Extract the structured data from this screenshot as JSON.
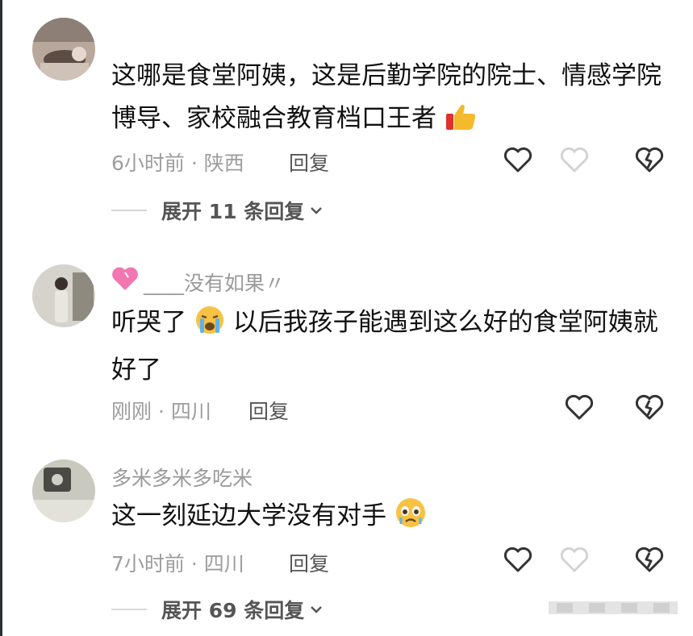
{
  "comments": [
    {
      "username": "",
      "text": "这哪是食堂阿姨，这是后勤学院的院士、情感学院博导、家校融合教育档口王者",
      "emoji": "thumbs-up-icon",
      "time": "6小时前",
      "location": "陕西",
      "reply_label": "回复",
      "expand_label": "展开 11 条回复"
    },
    {
      "username": "____没有如果〃",
      "text_before": "听哭了",
      "text_after": "以后我孩子能遇到这么好的食堂阿姨就好了",
      "emoji": "loudly-crying-face-icon",
      "badge": "pink-heart-icon",
      "time": "刚刚",
      "location": "四川",
      "reply_label": "回复"
    },
    {
      "username": "多米多米多吃米",
      "text": "这一刻延边大学没有对手",
      "emoji": "teary-face-icon",
      "time": "7小时前",
      "location": "四川",
      "reply_label": "回复",
      "expand_label": "展开 69 条回复"
    }
  ],
  "separator": "·",
  "colors": {
    "muted": "#9d9d9d",
    "text": "#111111",
    "icon": "#333333"
  }
}
